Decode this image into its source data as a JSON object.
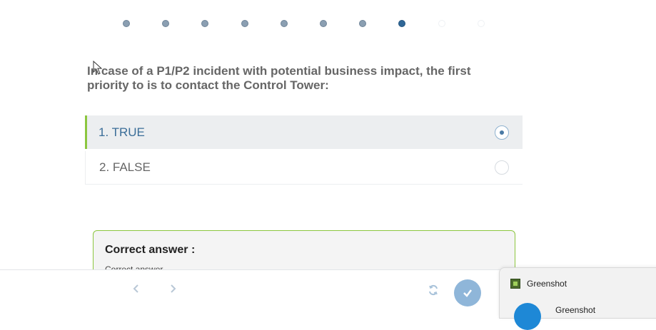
{
  "progress": {
    "steps": [
      "done",
      "done",
      "done",
      "done",
      "done",
      "done",
      "done",
      "current",
      "todo",
      "todo"
    ],
    "colors": {
      "done": "#8b9fb2",
      "current": "#2f6797",
      "todo": "#ffffff"
    }
  },
  "question": {
    "text": "In case of a P1/P2 incident with potential business impact, the first priority to is to contact the Control Tower:"
  },
  "options": [
    {
      "label": "1. TRUE",
      "selected": true
    },
    {
      "label": "2. FALSE",
      "selected": false
    }
  ],
  "answer": {
    "title": "Correct answer :",
    "text": "Correct answer"
  },
  "toolbar": {
    "prev_icon": "chevron-left-icon",
    "next_icon": "chevron-right-icon",
    "refresh_icon": "refresh-icon",
    "submit_icon": "check-icon"
  },
  "notification": {
    "app": "Greenshot",
    "title": "Greenshot"
  },
  "colors": {
    "accent_green": "#8cc63f",
    "selected_text": "#3a6d98",
    "submit_button": "#8fb6d9"
  }
}
